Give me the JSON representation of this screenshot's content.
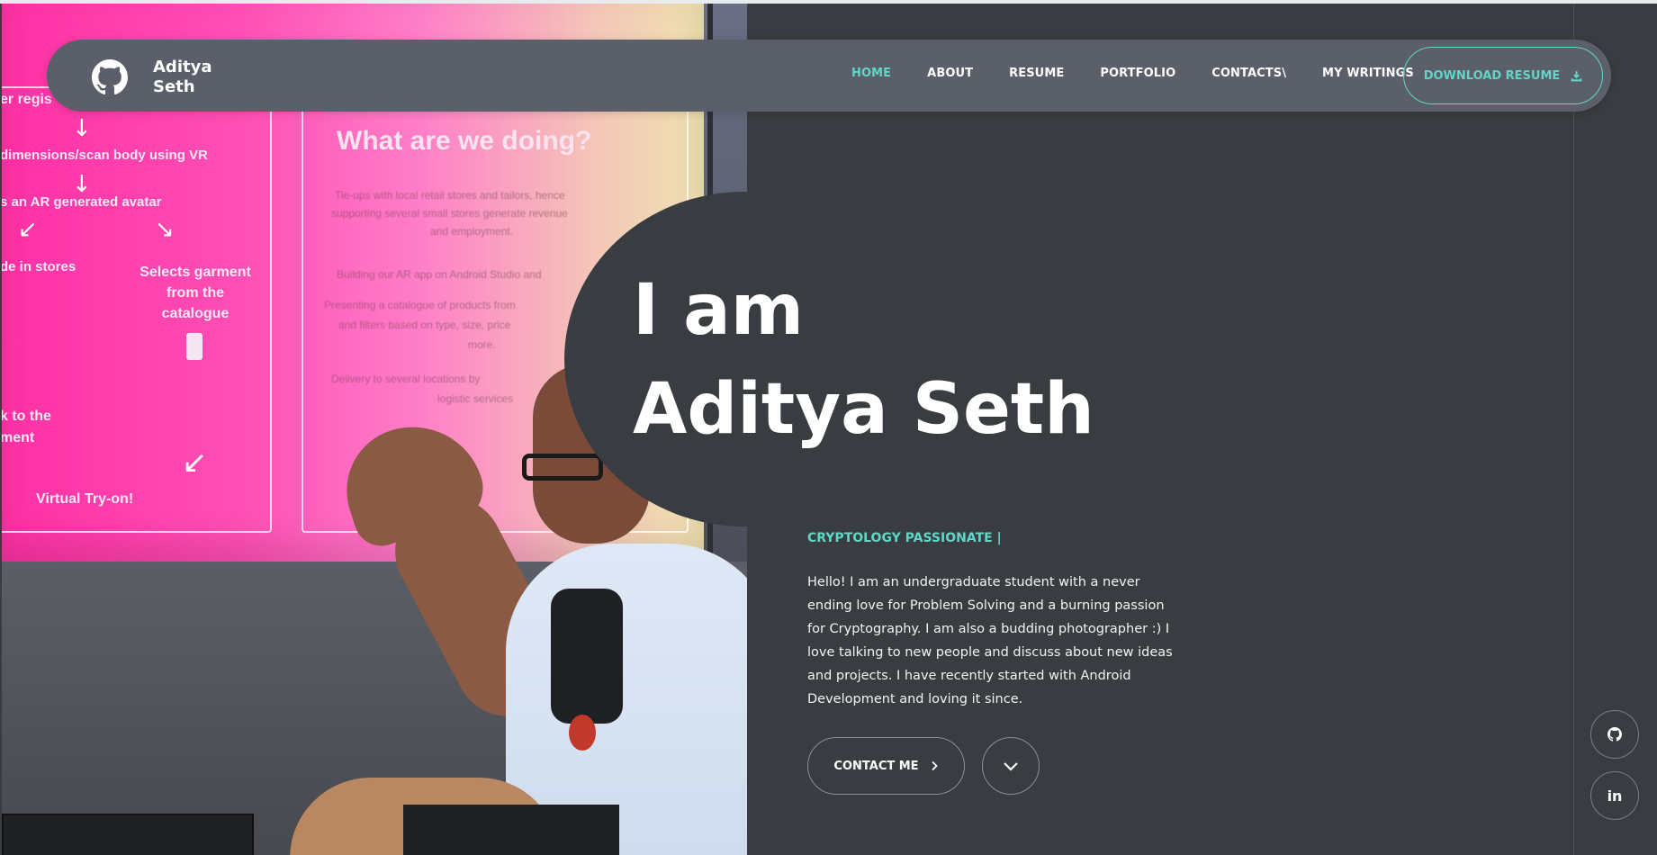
{
  "brand": {
    "name": "Aditya Seth",
    "logo_icon": "github-icon"
  },
  "nav": {
    "items": [
      {
        "label": "HOME",
        "active": true
      },
      {
        "label": "ABOUT",
        "active": false
      },
      {
        "label": "RESUME",
        "active": false
      },
      {
        "label": "PORTFOLIO",
        "active": false
      },
      {
        "label": "CONTACTS\\",
        "active": false
      },
      {
        "label": "MY WRITINGS",
        "active": false
      }
    ],
    "download_label": "DOWNLOAD RESUME",
    "download_icon": "download-icon"
  },
  "hero": {
    "line1": "I am",
    "line2": "Aditya Seth",
    "tagline": "CRYPTOLOGY PASSIONATE |",
    "bio": "Hello! I am an undergraduate student with a never ending love for Problem Solving and a burning passion for Cryptography. I am also a budding photographer :) I love talking to new people and discuss about new ideas and projects. I have recently started with Android Development and loving it since.",
    "contact_label": "CONTACT ME",
    "contact_icon": "chevron-right-icon",
    "scroll_icon": "chevron-down-icon"
  },
  "photo": {
    "slide_heading": "What are we doing?",
    "left_panel_lines": [
      "er regis",
      "dimensions/scan body using VR",
      "s an AR generated avatar",
      "de in stores",
      "Selects garment",
      "from the",
      "catalogue",
      "k to the",
      "ment",
      "Virtual Try-on!"
    ],
    "right_panel_lines": [
      "Tie-ups with local retail stores and tailors, hence",
      "supporting several small stores generate revenue",
      "and employment.",
      "Building our AR app on Android Studio and",
      "Presenting a catalogue of products from",
      "and filters based on type, size, price",
      "more.",
      "Delivery to several locations by",
      "logistic services"
    ]
  },
  "social": [
    {
      "name": "github",
      "icon": "github-icon"
    },
    {
      "name": "linkedin",
      "icon": "linkedin-icon",
      "text": "in"
    }
  ],
  "colors": {
    "accent": "#5fd6c6",
    "background": "#393c40",
    "navbar": "#5b5f69",
    "text": "#ffffff"
  }
}
